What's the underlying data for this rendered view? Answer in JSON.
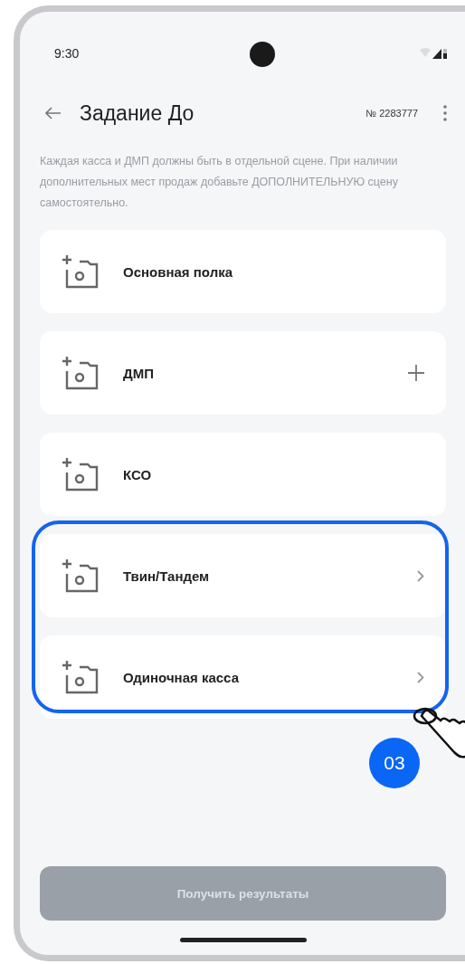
{
  "status_bar": {
    "time": "9:30"
  },
  "header": {
    "title": "Задание До",
    "number": "№ 2283777"
  },
  "description": "Каждая касса и ДМП должны быть в отдельной сцене. При наличии дополнительных мест продаж добавьте ДОПОЛНИТЕЛЬНУЮ сцену самостоятельно.",
  "items": [
    {
      "label": "Основная полка",
      "kind": "plain",
      "highlighted": false
    },
    {
      "label": "ДМП",
      "kind": "add",
      "highlighted": false
    },
    {
      "label": "КСО",
      "kind": "plain",
      "highlighted": false
    },
    {
      "label": "Твин/Тандем",
      "kind": "chevron",
      "highlighted": true
    },
    {
      "label": "Одиночная касса",
      "kind": "chevron",
      "highlighted": true
    }
  ],
  "annotation": {
    "badge": "03"
  },
  "button": {
    "label": "Получить результаты",
    "disabled": true
  }
}
